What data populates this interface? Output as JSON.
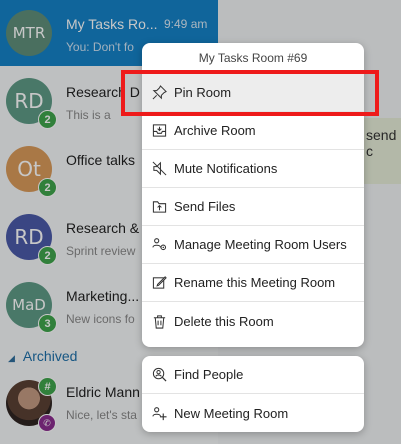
{
  "chats": [
    {
      "initials": "MTR",
      "title": "My Tasks Ro...",
      "time": "9:49 am",
      "subtitle": "You: Don't fo",
      "color": "#5f8f7a",
      "selected": true,
      "badge": ""
    },
    {
      "initials": "RD",
      "title": "Research D",
      "time": "",
      "subtitle": "This is a",
      "color": "#5e9a86",
      "selected": false,
      "badge": "2"
    },
    {
      "initials": "Ot",
      "title": "Office talks",
      "time": "",
      "subtitle": "",
      "color": "#d99a5a",
      "selected": false,
      "badge": "2"
    },
    {
      "initials": "RD",
      "title": "Research &",
      "time": "",
      "subtitle": "Sprint review",
      "color": "#4b5aa8",
      "selected": false,
      "badge": "2"
    },
    {
      "initials": "MaD",
      "title": "Marketing...",
      "time": "",
      "subtitle": "New icons fo",
      "color": "#5e9a86",
      "selected": false,
      "badge": "3"
    }
  ],
  "archived": {
    "header": "Archived",
    "item": {
      "title": "Eldric Mann",
      "subtitle": "Nice, let's sta",
      "badge": "#"
    }
  },
  "right_pane": {
    "peek_text": "send c"
  },
  "context_menu": {
    "title": "My Tasks Room #69",
    "items": [
      {
        "label": "Pin Room",
        "icon": "pin-icon"
      },
      {
        "label": "Archive Room",
        "icon": "archive-icon"
      },
      {
        "label": "Mute Notifications",
        "icon": "mute-icon"
      },
      {
        "label": "Send Files",
        "icon": "send-files-icon"
      },
      {
        "label": "Manage Meeting Room Users",
        "icon": "manage-users-icon"
      },
      {
        "label": "Rename this Meeting Room",
        "icon": "rename-icon"
      },
      {
        "label": "Delete this Room",
        "icon": "trash-icon"
      }
    ],
    "secondary_items": [
      {
        "label": "Find People",
        "icon": "find-people-icon"
      },
      {
        "label": "New Meeting Room",
        "icon": "new-room-icon"
      }
    ]
  },
  "colors": {
    "selected": "#1582c7",
    "badge": "#3fa44c",
    "highlight": "#ee1a1a"
  }
}
